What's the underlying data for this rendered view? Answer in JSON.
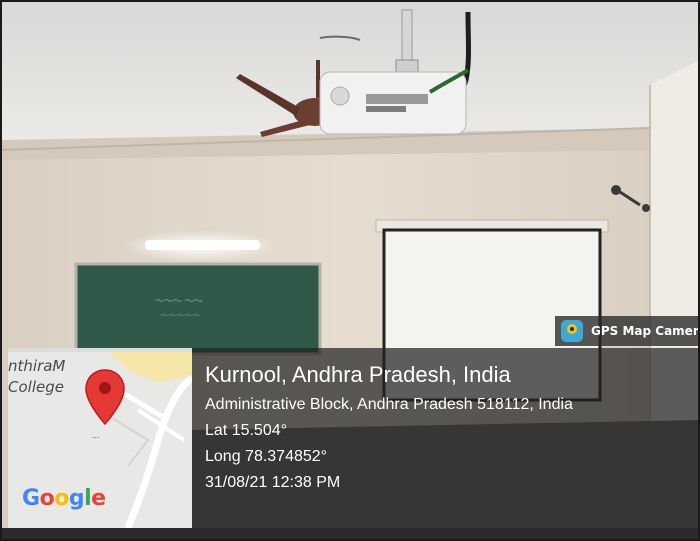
{
  "overlay": {
    "app_label": "GPS Map Camera",
    "location_title": "Kurnool, Andhra Pradesh, India",
    "address": "Administrative Block, Andhra Pradesh 518112, India",
    "latitude": "Lat 15.504°",
    "longitude": "Long 78.374852°",
    "timestamp": "31/08/21 12:38 PM"
  },
  "map": {
    "place_line1": "nthiraM",
    "place_line2": "College",
    "logo": "Google",
    "marker_dots": "...",
    "marker_icon": "map-pin-icon"
  },
  "colors": {
    "google_blue": "#4285F4",
    "google_red": "#EA4335",
    "google_yellow": "#FBBC05",
    "google_green": "#34A853",
    "overlay_bg": "#232323"
  }
}
